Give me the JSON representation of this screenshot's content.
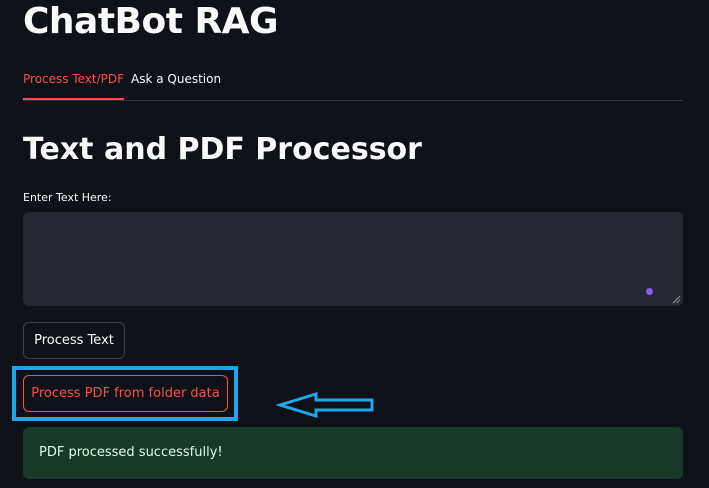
{
  "app": {
    "title": "ChatBot RAG"
  },
  "tabs": [
    {
      "label": "Process Text/PDF",
      "active": true
    },
    {
      "label": "Ask a Question",
      "active": false
    }
  ],
  "main": {
    "section_title": "Text and PDF Processor",
    "text_input": {
      "label": "Enter Text Here:",
      "value": "",
      "placeholder": ""
    },
    "process_text_button": "Process Text",
    "process_pdf_button": "Process PDF from folder data",
    "success_message": "PDF processed successfully!"
  },
  "annotation": {
    "highlight_color": "#1ea6e8",
    "arrow_direction": "left"
  },
  "colors": {
    "background": "#0e1117",
    "accent": "#ff4b4b",
    "input_background": "#262730",
    "success_background": "#173928",
    "success_text": "#dffde9"
  },
  "icons": {
    "status_indicator": "purple-dot-icon",
    "resize": "resize-handle-icon",
    "arrow": "arrow-left-icon"
  }
}
